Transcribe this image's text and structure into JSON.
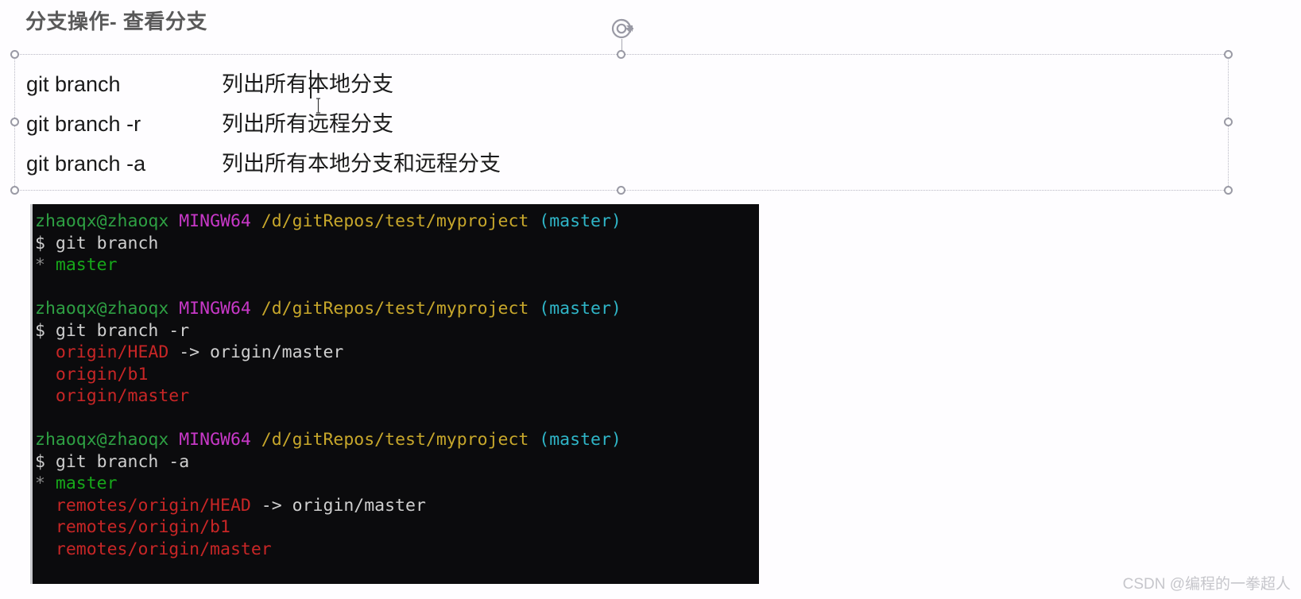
{
  "slide": {
    "title": "分支操作- 查看分支",
    "title_color": "#595959",
    "background_color": "#fefdff"
  },
  "textbox": {
    "selected": true,
    "rows": [
      {
        "command": "git branch",
        "description": "列出所有本地分支"
      },
      {
        "command": "git branch -r",
        "description": "列出所有远程分支"
      },
      {
        "command": "git branch -a",
        "description": "列出所有本地分支和远程分支"
      }
    ],
    "caret_visible": true,
    "handles": [
      "top-left",
      "top-center",
      "top-right",
      "middle-left",
      "middle-right",
      "bottom-left",
      "bottom-center",
      "bottom-right"
    ],
    "rotate_handle_label": "rotate-handle"
  },
  "terminal": {
    "background_color": "#0b0b0d",
    "colors": {
      "user": "#2ea043",
      "shell": "#c838c8",
      "path": "#c7a72b",
      "branch": "#2fb5c7",
      "remote": "#c82626",
      "text": "#cfcfcf",
      "local_branch": "#17a81a"
    },
    "blocks": [
      {
        "prompt": {
          "user": "zhaoqx@zhaoqx",
          "shell": "MINGW64",
          "path": "/d/gitRepos/test/myproject",
          "branch": "(master)"
        },
        "command": "$ git branch",
        "output": [
          {
            "marker": "*",
            "name": "master",
            "kind": "local"
          }
        ]
      },
      {
        "prompt": {
          "user": "zhaoqx@zhaoqx",
          "shell": "MINGW64",
          "path": "/d/gitRepos/test/myproject",
          "branch": "(master)"
        },
        "command": "$ git branch -r",
        "output": [
          {
            "marker": " ",
            "name": "origin/HEAD",
            "kind": "remote",
            "suffix": " -> origin/master"
          },
          {
            "marker": " ",
            "name": "origin/b1",
            "kind": "remote",
            "suffix": ""
          },
          {
            "marker": " ",
            "name": "origin/master",
            "kind": "remote",
            "suffix": ""
          }
        ]
      },
      {
        "prompt": {
          "user": "zhaoqx@zhaoqx",
          "shell": "MINGW64",
          "path": "/d/gitRepos/test/myproject",
          "branch": "(master)"
        },
        "command": "$ git branch -a",
        "output": [
          {
            "marker": "*",
            "name": "master",
            "kind": "local",
            "suffix": ""
          },
          {
            "marker": " ",
            "name": "remotes/origin/HEAD",
            "kind": "remote",
            "suffix": " -> origin/master"
          },
          {
            "marker": " ",
            "name": "remotes/origin/b1",
            "kind": "remote",
            "suffix": ""
          },
          {
            "marker": " ",
            "name": "remotes/origin/master",
            "kind": "remote",
            "suffix": ""
          }
        ]
      }
    ]
  },
  "watermark": {
    "text": "CSDN @编程的一拳超人"
  }
}
